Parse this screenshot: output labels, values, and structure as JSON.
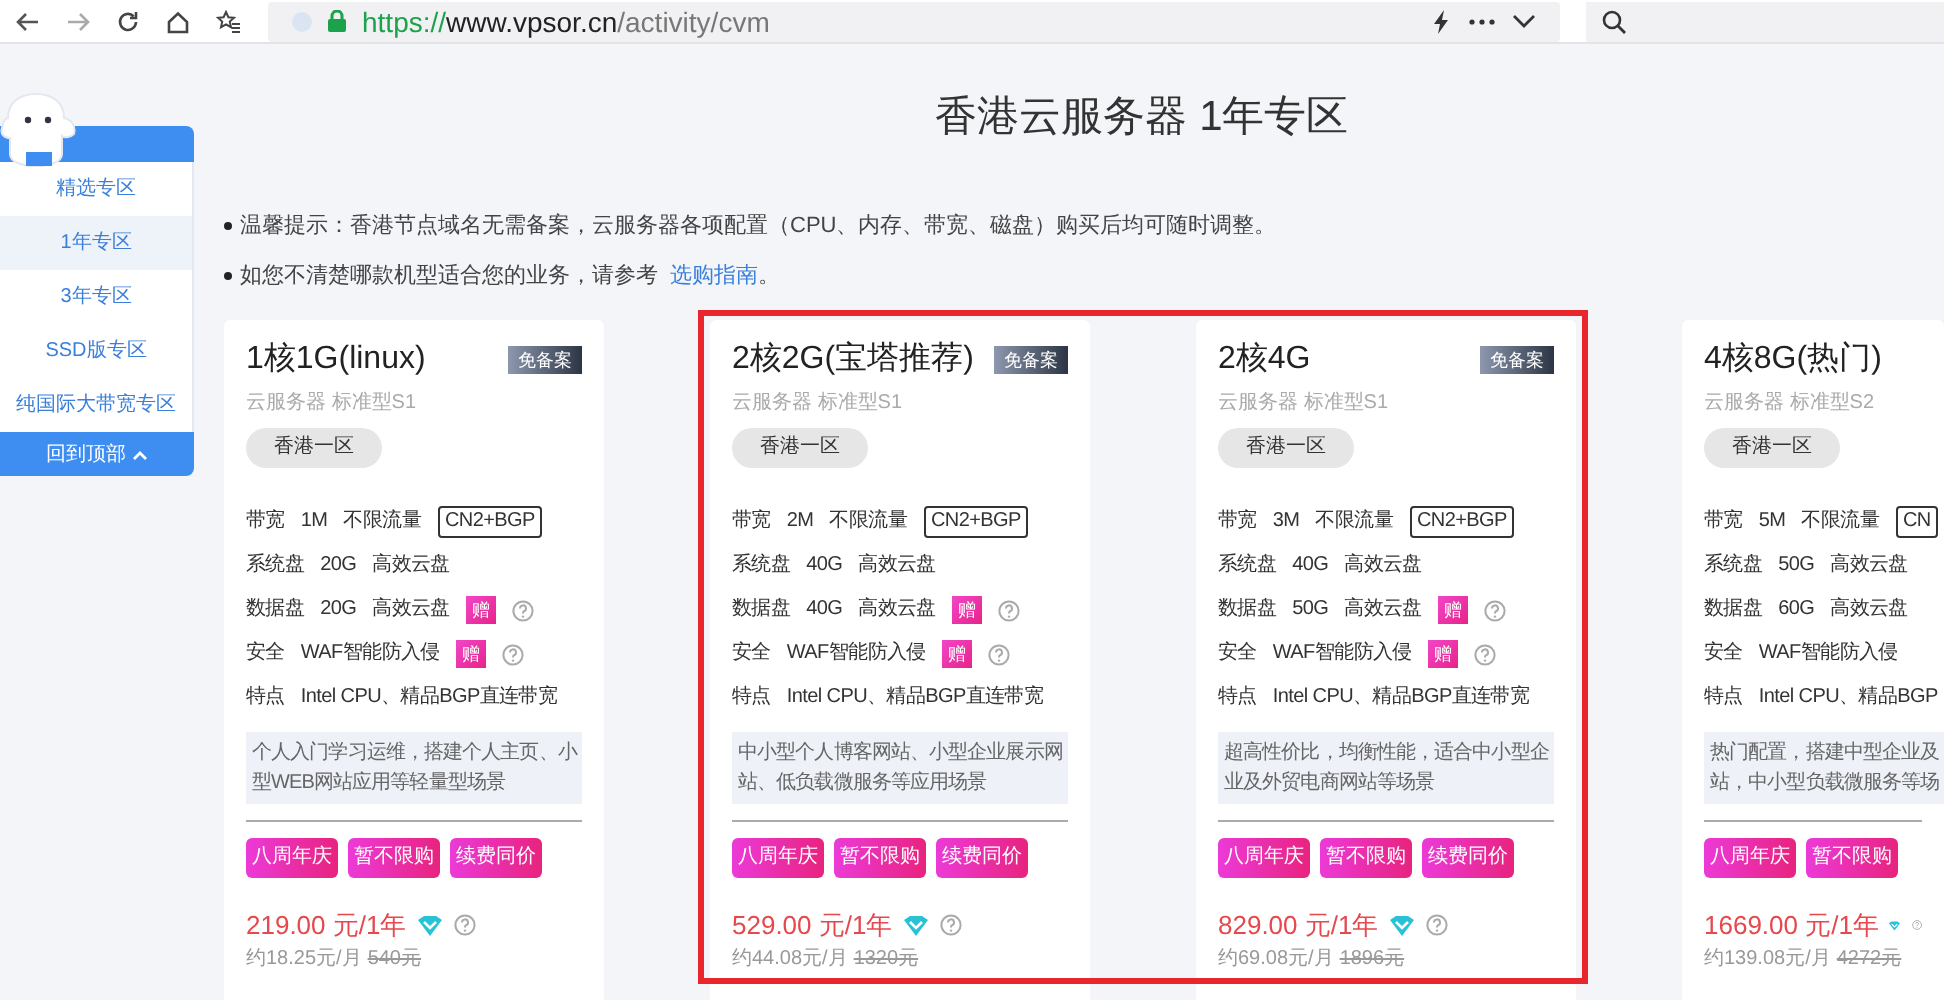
{
  "browser": {
    "url": {
      "scheme": "https://",
      "host": "www.vpsor.cn",
      "path": "/activity/cvm"
    }
  },
  "sidebar": {
    "items": [
      {
        "label": "精选专区",
        "selected": false
      },
      {
        "label": "1年专区",
        "selected": true
      },
      {
        "label": "3年专区",
        "selected": false
      },
      {
        "label": "SSD版专区",
        "selected": false
      },
      {
        "label": "纯国际大带宽专区",
        "selected": false
      }
    ],
    "back_to_top": "回到顶部"
  },
  "title": "香港云服务器 1年专区",
  "notes": [
    {
      "text": "温馨提示：香港节点域名无需备案，云服务器各项配置（CPU、内存、带宽、磁盘）购买后均可随时调整。"
    },
    {
      "text": "如您不清楚哪款机型适合您的业务，请参考",
      "link": "选购指南",
      "after": "。"
    }
  ],
  "cards": [
    {
      "title": "1核1G(linux)",
      "badge": "免备案",
      "subtitle": "云服务器 标准型S1",
      "region": "香港一区",
      "highlighted": false,
      "specs": [
        {
          "cells": [
            "带宽",
            "1M",
            "不限流量"
          ],
          "tag": "CN2+BGP",
          "help": false
        },
        {
          "cells": [
            "系统盘",
            "20G",
            "高效云盘"
          ],
          "help": false
        },
        {
          "cells": [
            "数据盘",
            "20G",
            "高效云盘"
          ],
          "gift": "赠",
          "help": true
        },
        {
          "cells": [
            "安全",
            "WAF智能防入侵"
          ],
          "gift": "赠",
          "help": true
        },
        {
          "cells": [
            "特点",
            "Intel CPU、精品BGP直连带宽"
          ],
          "help": false
        }
      ],
      "description": [
        "个人入门学习运维，搭建个人主页、小",
        "型WEB网站应用等轻量型场景"
      ],
      "tags": [
        "八周年庆",
        "暂不限购",
        "续费同价"
      ],
      "price": "219.00 元/1年",
      "monthly": "约18.25元/月",
      "original": "540元"
    },
    {
      "title": "2核2G(宝塔推荐)",
      "badge": "免备案",
      "subtitle": "云服务器 标准型S1",
      "region": "香港一区",
      "highlighted": true,
      "specs": [
        {
          "cells": [
            "带宽",
            "2M",
            "不限流量"
          ],
          "tag": "CN2+BGP",
          "help": false
        },
        {
          "cells": [
            "系统盘",
            "40G",
            "高效云盘"
          ],
          "help": false
        },
        {
          "cells": [
            "数据盘",
            "40G",
            "高效云盘"
          ],
          "gift": "赠",
          "help": true
        },
        {
          "cells": [
            "安全",
            "WAF智能防入侵"
          ],
          "gift": "赠",
          "help": true
        },
        {
          "cells": [
            "特点",
            "Intel CPU、精品BGP直连带宽"
          ],
          "help": false
        }
      ],
      "description": [
        "中小型个人博客网站、小型企业展示网",
        "站、低负载微服务等应用场景"
      ],
      "tags": [
        "八周年庆",
        "暂不限购",
        "续费同价"
      ],
      "price": "529.00 元/1年",
      "monthly": "约44.08元/月",
      "original": "1320元"
    },
    {
      "title": "2核4G",
      "badge": "免备案",
      "subtitle": "云服务器 标准型S1",
      "region": "香港一区",
      "highlighted": true,
      "specs": [
        {
          "cells": [
            "带宽",
            "3M",
            "不限流量"
          ],
          "tag": "CN2+BGP",
          "help": false
        },
        {
          "cells": [
            "系统盘",
            "40G",
            "高效云盘"
          ],
          "help": false
        },
        {
          "cells": [
            "数据盘",
            "50G",
            "高效云盘"
          ],
          "gift": "赠",
          "help": true
        },
        {
          "cells": [
            "安全",
            "WAF智能防入侵"
          ],
          "gift": "赠",
          "help": true
        },
        {
          "cells": [
            "特点",
            "Intel CPU、精品BGP直连带宽"
          ],
          "help": false
        }
      ],
      "description": [
        "超高性价比，均衡性能，适合中小型企",
        "业及外贸电商网站等场景"
      ],
      "tags": [
        "八周年庆",
        "暂不限购",
        "续费同价"
      ],
      "price": "829.00 元/1年",
      "monthly": "约69.08元/月",
      "original": "1896元"
    },
    {
      "title": "4核8G(热门)",
      "subtitle": "云服务器 标准型S2",
      "region": "香港一区",
      "highlighted": false,
      "specs": [
        {
          "cells": [
            "带宽",
            "5M",
            "不限流量"
          ],
          "tag": "CN",
          "help": false
        },
        {
          "cells": [
            "系统盘",
            "50G",
            "高效云盘"
          ],
          "help": false
        },
        {
          "cells": [
            "数据盘",
            "60G",
            "高效云盘"
          ],
          "help": false
        },
        {
          "cells": [
            "安全",
            "WAF智能防入侵"
          ],
          "help": false
        },
        {
          "cells": [
            "特点",
            "Intel CPU、精品BGP"
          ],
          "help": false
        }
      ],
      "description": [
        "热门配置，搭建中型企业及",
        "站，中小型负载微服务等场"
      ],
      "tags": [
        "八周年庆",
        "暂不限购"
      ],
      "price": "1669.00 元/1年",
      "monthly": "约139.08元/月",
      "original": "4272元"
    }
  ]
}
